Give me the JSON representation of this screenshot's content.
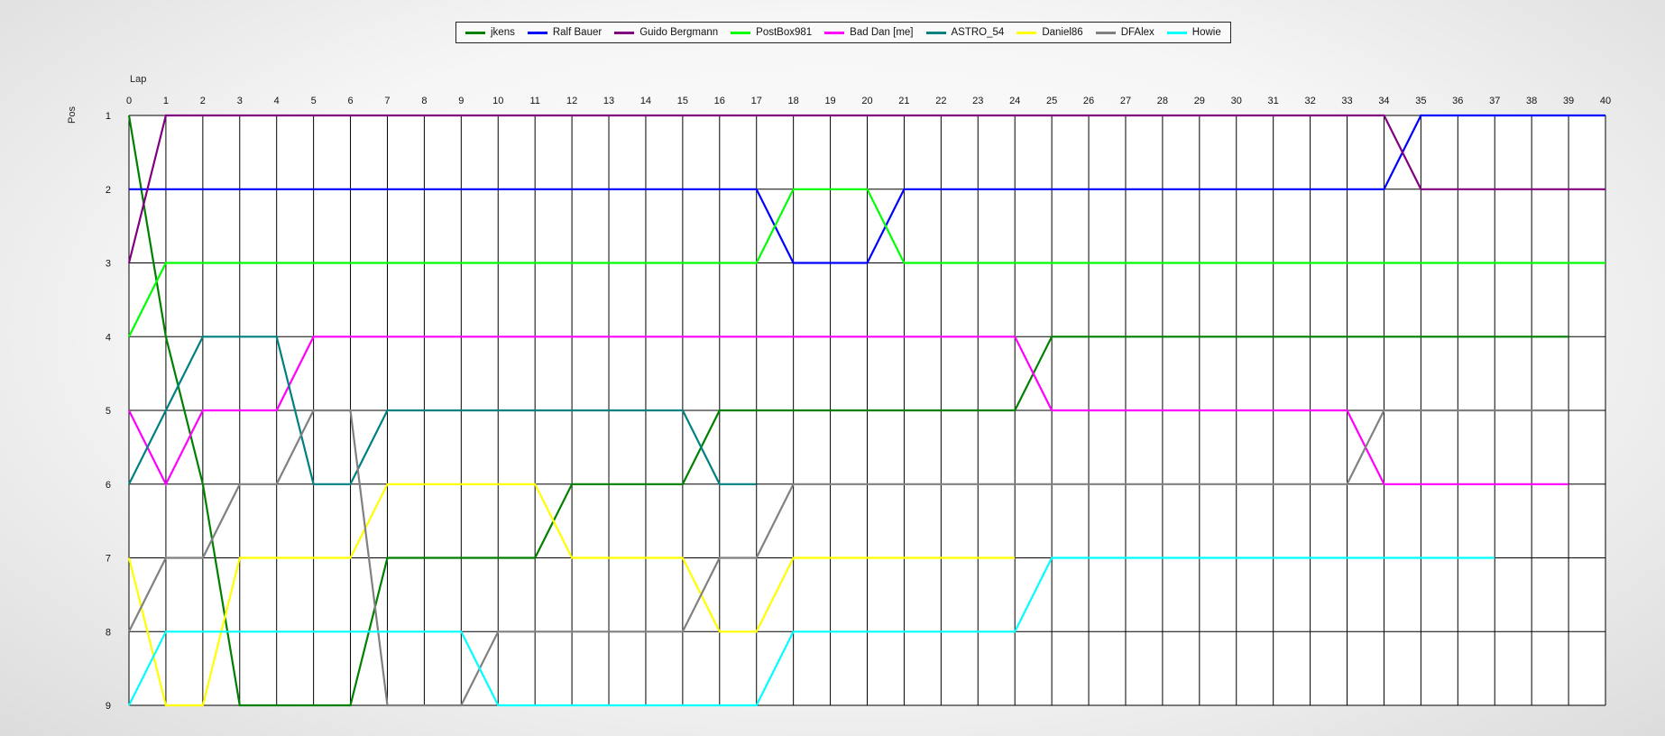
{
  "chart_data": {
    "type": "line",
    "title": "",
    "xlabel": "Lap",
    "ylabel": "Pos",
    "xlim": [
      0,
      40
    ],
    "ylim": [
      1,
      9
    ],
    "y_inverted": true,
    "grid": true,
    "legend_placement": "top-center",
    "x_ticks": [
      0,
      1,
      2,
      3,
      4,
      5,
      6,
      7,
      8,
      9,
      10,
      11,
      12,
      13,
      14,
      15,
      16,
      17,
      18,
      19,
      20,
      21,
      22,
      23,
      24,
      25,
      26,
      27,
      28,
      29,
      30,
      31,
      32,
      33,
      34,
      35,
      36,
      37,
      38,
      39,
      40
    ],
    "y_ticks": [
      1,
      2,
      3,
      4,
      5,
      6,
      7,
      8,
      9
    ],
    "series": [
      {
        "name": "jkens",
        "color": "#008000",
        "points": [
          [
            0,
            1
          ],
          [
            1,
            4
          ],
          [
            2,
            6
          ],
          [
            3,
            9
          ],
          [
            4,
            9
          ],
          [
            5,
            9
          ],
          [
            6,
            9
          ],
          [
            7,
            7
          ],
          [
            8,
            7
          ],
          [
            9,
            7
          ],
          [
            10,
            7
          ],
          [
            11,
            7
          ],
          [
            12,
            6
          ],
          [
            13,
            6
          ],
          [
            14,
            6
          ],
          [
            15,
            6
          ],
          [
            16,
            5
          ],
          [
            17,
            5
          ],
          [
            18,
            5
          ],
          [
            19,
            5
          ],
          [
            20,
            5
          ],
          [
            21,
            5
          ],
          [
            22,
            5
          ],
          [
            23,
            5
          ],
          [
            24,
            5
          ],
          [
            25,
            4
          ],
          [
            26,
            4
          ],
          [
            27,
            4
          ],
          [
            28,
            4
          ],
          [
            29,
            4
          ],
          [
            30,
            4
          ],
          [
            31,
            4
          ],
          [
            32,
            4
          ],
          [
            33,
            4
          ],
          [
            34,
            4
          ],
          [
            35,
            4
          ],
          [
            36,
            4
          ],
          [
            37,
            4
          ],
          [
            38,
            4
          ],
          [
            39,
            4
          ]
        ]
      },
      {
        "name": "Ralf Bauer",
        "color": "#0000ff",
        "points": [
          [
            0,
            2
          ],
          [
            1,
            2
          ],
          [
            2,
            2
          ],
          [
            3,
            2
          ],
          [
            4,
            2
          ],
          [
            5,
            2
          ],
          [
            6,
            2
          ],
          [
            7,
            2
          ],
          [
            8,
            2
          ],
          [
            9,
            2
          ],
          [
            10,
            2
          ],
          [
            11,
            2
          ],
          [
            12,
            2
          ],
          [
            13,
            2
          ],
          [
            14,
            2
          ],
          [
            15,
            2
          ],
          [
            16,
            2
          ],
          [
            17,
            2
          ],
          [
            18,
            3
          ],
          [
            19,
            3
          ],
          [
            20,
            3
          ],
          [
            21,
            2
          ],
          [
            22,
            2
          ],
          [
            23,
            2
          ],
          [
            24,
            2
          ],
          [
            25,
            2
          ],
          [
            26,
            2
          ],
          [
            27,
            2
          ],
          [
            28,
            2
          ],
          [
            29,
            2
          ],
          [
            30,
            2
          ],
          [
            31,
            2
          ],
          [
            32,
            2
          ],
          [
            33,
            2
          ],
          [
            34,
            2
          ],
          [
            35,
            1
          ],
          [
            36,
            1
          ],
          [
            37,
            1
          ],
          [
            38,
            1
          ],
          [
            39,
            1
          ],
          [
            40,
            1
          ]
        ]
      },
      {
        "name": "Guido Bergmann",
        "color": "#800080",
        "points": [
          [
            0,
            3
          ],
          [
            1,
            1
          ],
          [
            2,
            1
          ],
          [
            3,
            1
          ],
          [
            4,
            1
          ],
          [
            5,
            1
          ],
          [
            6,
            1
          ],
          [
            7,
            1
          ],
          [
            8,
            1
          ],
          [
            9,
            1
          ],
          [
            10,
            1
          ],
          [
            11,
            1
          ],
          [
            12,
            1
          ],
          [
            13,
            1
          ],
          [
            14,
            1
          ],
          [
            15,
            1
          ],
          [
            16,
            1
          ],
          [
            17,
            1
          ],
          [
            18,
            1
          ],
          [
            19,
            1
          ],
          [
            20,
            1
          ],
          [
            21,
            1
          ],
          [
            22,
            1
          ],
          [
            23,
            1
          ],
          [
            24,
            1
          ],
          [
            25,
            1
          ],
          [
            26,
            1
          ],
          [
            27,
            1
          ],
          [
            28,
            1
          ],
          [
            29,
            1
          ],
          [
            30,
            1
          ],
          [
            31,
            1
          ],
          [
            32,
            1
          ],
          [
            33,
            1
          ],
          [
            34,
            1
          ],
          [
            35,
            2
          ],
          [
            36,
            2
          ],
          [
            37,
            2
          ],
          [
            38,
            2
          ],
          [
            39,
            2
          ],
          [
            40,
            2
          ]
        ]
      },
      {
        "name": "PostBox981",
        "color": "#00ff00",
        "points": [
          [
            0,
            4
          ],
          [
            1,
            3
          ],
          [
            2,
            3
          ],
          [
            3,
            3
          ],
          [
            4,
            3
          ],
          [
            5,
            3
          ],
          [
            6,
            3
          ],
          [
            7,
            3
          ],
          [
            8,
            3
          ],
          [
            9,
            3
          ],
          [
            10,
            3
          ],
          [
            11,
            3
          ],
          [
            12,
            3
          ],
          [
            13,
            3
          ],
          [
            14,
            3
          ],
          [
            15,
            3
          ],
          [
            16,
            3
          ],
          [
            17,
            3
          ],
          [
            18,
            2
          ],
          [
            19,
            2
          ],
          [
            20,
            2
          ],
          [
            21,
            3
          ],
          [
            22,
            3
          ],
          [
            23,
            3
          ],
          [
            24,
            3
          ],
          [
            25,
            3
          ],
          [
            26,
            3
          ],
          [
            27,
            3
          ],
          [
            28,
            3
          ],
          [
            29,
            3
          ],
          [
            30,
            3
          ],
          [
            31,
            3
          ],
          [
            32,
            3
          ],
          [
            33,
            3
          ],
          [
            34,
            3
          ],
          [
            35,
            3
          ],
          [
            36,
            3
          ],
          [
            37,
            3
          ],
          [
            38,
            3
          ],
          [
            39,
            3
          ],
          [
            40,
            3
          ]
        ]
      },
      {
        "name": "Bad Dan [me]",
        "color": "#ff00ff",
        "points": [
          [
            0,
            5
          ],
          [
            1,
            6
          ],
          [
            2,
            5
          ],
          [
            3,
            5
          ],
          [
            4,
            5
          ],
          [
            5,
            4
          ],
          [
            6,
            4
          ],
          [
            7,
            4
          ],
          [
            8,
            4
          ],
          [
            9,
            4
          ],
          [
            10,
            4
          ],
          [
            11,
            4
          ],
          [
            12,
            4
          ],
          [
            13,
            4
          ],
          [
            14,
            4
          ],
          [
            15,
            4
          ],
          [
            16,
            4
          ],
          [
            17,
            4
          ],
          [
            18,
            4
          ],
          [
            19,
            4
          ],
          [
            20,
            4
          ],
          [
            21,
            4
          ],
          [
            22,
            4
          ],
          [
            23,
            4
          ],
          [
            24,
            4
          ],
          [
            25,
            5
          ],
          [
            26,
            5
          ],
          [
            27,
            5
          ],
          [
            28,
            5
          ],
          [
            29,
            5
          ],
          [
            30,
            5
          ],
          [
            31,
            5
          ],
          [
            32,
            5
          ],
          [
            33,
            5
          ],
          [
            34,
            6
          ],
          [
            35,
            6
          ],
          [
            36,
            6
          ],
          [
            37,
            6
          ],
          [
            38,
            6
          ],
          [
            39,
            6
          ]
        ]
      },
      {
        "name": "ASTRO_54",
        "color": "#008080",
        "points": [
          [
            0,
            6
          ],
          [
            1,
            5
          ],
          [
            2,
            4
          ],
          [
            3,
            4
          ],
          [
            4,
            4
          ],
          [
            5,
            6
          ],
          [
            6,
            6
          ],
          [
            7,
            5
          ],
          [
            8,
            5
          ],
          [
            9,
            5
          ],
          [
            10,
            5
          ],
          [
            11,
            5
          ],
          [
            12,
            5
          ],
          [
            13,
            5
          ],
          [
            14,
            5
          ],
          [
            15,
            5
          ],
          [
            16,
            6
          ],
          [
            17,
            6
          ]
        ]
      },
      {
        "name": "Daniel86",
        "color": "#ffff00",
        "points": [
          [
            0,
            7
          ],
          [
            1,
            9
          ],
          [
            2,
            9
          ],
          [
            3,
            7
          ],
          [
            4,
            7
          ],
          [
            5,
            7
          ],
          [
            6,
            7
          ],
          [
            7,
            6
          ],
          [
            8,
            6
          ],
          [
            9,
            6
          ],
          [
            10,
            6
          ],
          [
            11,
            6
          ],
          [
            12,
            7
          ],
          [
            13,
            7
          ],
          [
            14,
            7
          ],
          [
            15,
            7
          ],
          [
            16,
            8
          ],
          [
            17,
            8
          ],
          [
            18,
            7
          ],
          [
            19,
            7
          ],
          [
            20,
            7
          ],
          [
            21,
            7
          ],
          [
            22,
            7
          ],
          [
            23,
            7
          ],
          [
            24,
            7
          ]
        ]
      },
      {
        "name": "DFAlex",
        "color": "#808080",
        "points": [
          [
            0,
            8
          ],
          [
            1,
            7
          ],
          [
            2,
            7
          ],
          [
            3,
            6
          ],
          [
            4,
            6
          ],
          [
            5,
            5
          ],
          [
            6,
            5
          ],
          [
            7,
            9
          ],
          [
            8,
            9
          ],
          [
            9,
            9
          ],
          [
            10,
            8
          ],
          [
            11,
            8
          ],
          [
            12,
            8
          ],
          [
            13,
            8
          ],
          [
            14,
            8
          ],
          [
            15,
            8
          ],
          [
            16,
            7
          ],
          [
            17,
            7
          ],
          [
            18,
            6
          ],
          [
            19,
            6
          ],
          [
            20,
            6
          ],
          [
            21,
            6
          ],
          [
            22,
            6
          ],
          [
            23,
            6
          ],
          [
            24,
            6
          ],
          [
            25,
            6
          ],
          [
            26,
            6
          ],
          [
            27,
            6
          ],
          [
            28,
            6
          ],
          [
            29,
            6
          ],
          [
            30,
            6
          ],
          [
            31,
            6
          ],
          [
            32,
            6
          ],
          [
            33,
            6
          ],
          [
            34,
            5
          ],
          [
            35,
            5
          ],
          [
            36,
            5
          ],
          [
            37,
            5
          ],
          [
            38,
            5
          ],
          [
            39,
            5
          ]
        ]
      },
      {
        "name": "Howie",
        "color": "#00ffff",
        "points": [
          [
            0,
            9
          ],
          [
            1,
            8
          ],
          [
            2,
            8
          ],
          [
            3,
            8
          ],
          [
            4,
            8
          ],
          [
            5,
            8
          ],
          [
            6,
            8
          ],
          [
            7,
            8
          ],
          [
            8,
            8
          ],
          [
            9,
            8
          ],
          [
            10,
            9
          ],
          [
            11,
            9
          ],
          [
            12,
            9
          ],
          [
            13,
            9
          ],
          [
            14,
            9
          ],
          [
            15,
            9
          ],
          [
            16,
            9
          ],
          [
            17,
            9
          ],
          [
            18,
            8
          ],
          [
            19,
            8
          ],
          [
            20,
            8
          ],
          [
            21,
            8
          ],
          [
            22,
            8
          ],
          [
            23,
            8
          ],
          [
            24,
            8
          ],
          [
            25,
            7
          ],
          [
            26,
            7
          ],
          [
            27,
            7
          ],
          [
            28,
            7
          ],
          [
            29,
            7
          ],
          [
            30,
            7
          ],
          [
            31,
            7
          ],
          [
            32,
            7
          ],
          [
            33,
            7
          ],
          [
            34,
            7
          ],
          [
            35,
            7
          ],
          [
            36,
            7
          ],
          [
            37,
            7
          ]
        ]
      }
    ]
  }
}
